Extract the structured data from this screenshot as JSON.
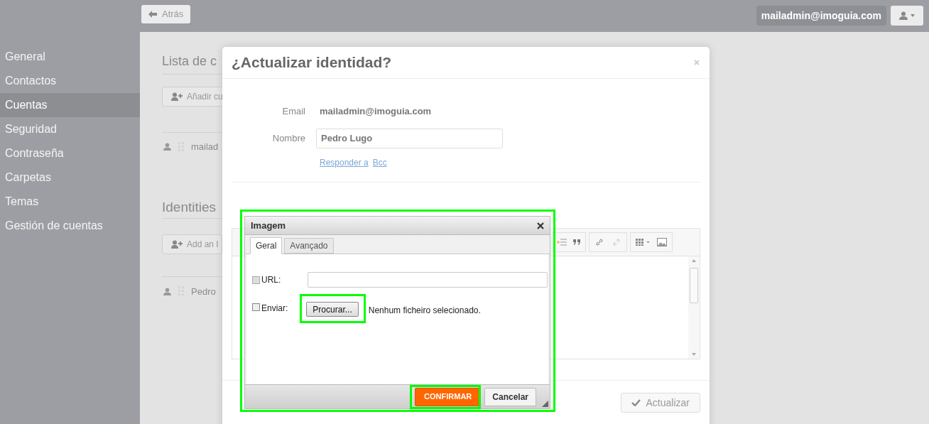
{
  "top_bar": {
    "back_button": "Atrás",
    "user_email": "mailadmin@imoguia.com"
  },
  "sidebar": {
    "items": [
      {
        "label": "General",
        "selected": false
      },
      {
        "label": "Contactos",
        "selected": false
      },
      {
        "label": "Cuentas",
        "selected": true
      },
      {
        "label": "Seguridad",
        "selected": false
      },
      {
        "label": "Contraseña",
        "selected": false
      },
      {
        "label": "Carpetas",
        "selected": false
      },
      {
        "label": "Temas",
        "selected": false
      },
      {
        "label": "Gestión de cuentas",
        "selected": false
      }
    ]
  },
  "settings_panel": {
    "accounts_title": "Lista de c",
    "add_account_button": "Añadir cu",
    "account_row": "mailad",
    "identities_title": "Identities",
    "add_identity_button": "Add an I",
    "identity_row": "Pedro"
  },
  "modal": {
    "title": "¿Actualizar identidad?",
    "email_label": "Email",
    "email_value": "mailadmin@imoguia.com",
    "name_label": "Nombre",
    "name_value": "Pedro Lugo",
    "links": [
      "Responder a",
      "Bcc"
    ],
    "submit_button": "Actualizar"
  },
  "image_dialog": {
    "title": "Imagem",
    "highlighted": true,
    "tabs": [
      {
        "label": "Geral",
        "selected": true
      },
      {
        "label": "Avançado",
        "selected": false
      }
    ],
    "url_label": "URL:",
    "upload_label": "Enviar:",
    "upload_checked": false,
    "browse_button": {
      "label": "Procurar...",
      "highlighted": true
    },
    "file_status": "Nenhum ficheiro selecionado.",
    "confirm_button": {
      "label": "CONFIRMAR",
      "highlighted": true
    },
    "cancel_button": "Cancelar"
  }
}
